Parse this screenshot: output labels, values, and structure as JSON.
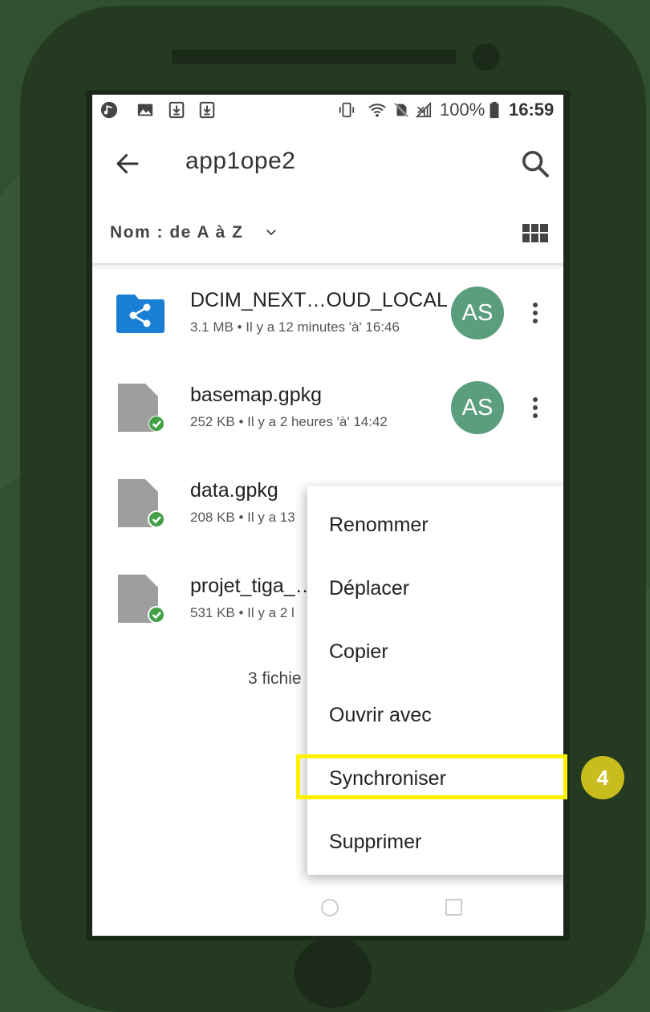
{
  "status_bar": {
    "battery": "100%",
    "time": "16:59",
    "icons": [
      "music-app-icon",
      "image-icon",
      "download-icon",
      "download-icon",
      "vibrate-icon",
      "wifi-icon",
      "no-sim-icon",
      "no-signal-icon",
      "battery-icon"
    ]
  },
  "app_bar": {
    "title": "app1ope2",
    "back_icon": "arrow-left-icon",
    "search_icon": "search-icon"
  },
  "sort_bar": {
    "label": "Nom : de A à Z",
    "view_icon": "grid-view-icon"
  },
  "files": [
    {
      "name": "DCIM_NEXT…OUD_LOCAL",
      "meta": "3.1 MB • Il y a 12 minutes 'à' 16:46",
      "type": "shared-folder",
      "avatar": "AS"
    },
    {
      "name": "basemap.gpkg",
      "meta": "252 KB • Il y a 2 heures 'à' 14:42",
      "type": "file-synced",
      "avatar": "AS"
    },
    {
      "name": "data.gpkg",
      "meta": "208 KB • Il y a 13",
      "type": "file-synced",
      "avatar": ""
    },
    {
      "name": "projet_tiga_…",
      "meta": "531 KB • Il y a 2 l",
      "type": "file-synced",
      "avatar": ""
    }
  ],
  "footer": {
    "count_text": "3 fichie"
  },
  "context_menu": {
    "items": [
      "Renommer",
      "Déplacer",
      "Copier",
      "Ouvrir avec",
      "Synchroniser",
      "Supprimer"
    ],
    "highlighted": "Synchroniser"
  },
  "annotation": {
    "step": "4",
    "highlight_color": "#fff200",
    "badge_color": "#c9bd1e"
  },
  "colors": {
    "avatar": "#5a9e7e",
    "folder": "#1a7fd4",
    "sync_check": "#43a047",
    "file_gray": "#9e9e9e",
    "phone_body": "#243b21"
  }
}
